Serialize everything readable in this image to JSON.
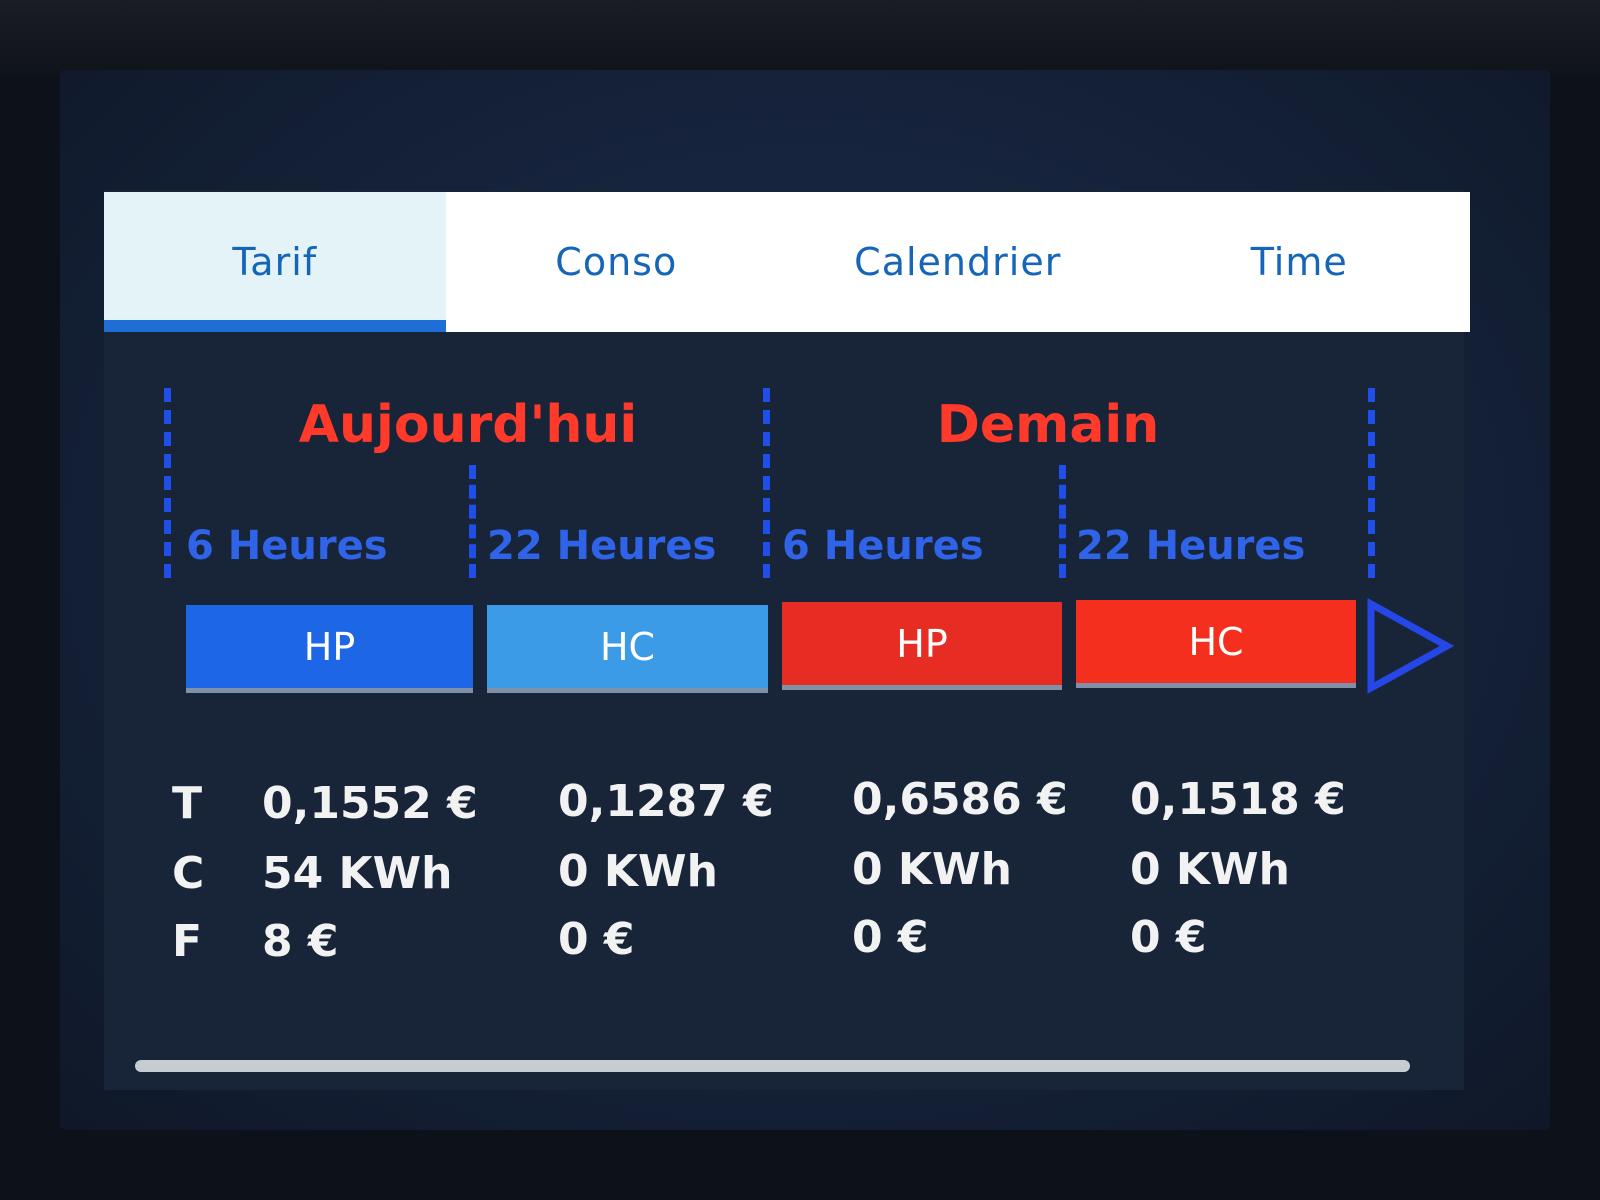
{
  "tabs": [
    {
      "label": "Tarif",
      "active": true
    },
    {
      "label": "Conso",
      "active": false
    },
    {
      "label": "Calendrier",
      "active": false
    },
    {
      "label": "Time",
      "active": false
    }
  ],
  "days": [
    {
      "title": "Aujourd'hui"
    },
    {
      "title": "Demain"
    }
  ],
  "periods": [
    {
      "hour": "6 Heures",
      "code": "HP",
      "color": "#1d66e6"
    },
    {
      "hour": "22 Heures",
      "code": "HC",
      "color": "#3c9be6"
    },
    {
      "hour": "6 Heures",
      "code": "HP",
      "color": "#e72d23"
    },
    {
      "hour": "22 Heures",
      "code": "HC",
      "color": "#f42f1e"
    }
  ],
  "next_icon": "play-arrow-icon",
  "rows": [
    {
      "label": "T",
      "values": [
        "0,1552 €",
        "0,1287 €",
        "0,6586 €",
        "0,1518 €"
      ]
    },
    {
      "label": "C",
      "values": [
        "54 KWh",
        "0 KWh",
        "0 KWh",
        "0 KWh"
      ]
    },
    {
      "label": "F",
      "values": [
        "8 €",
        "0 €",
        "0 €",
        "0 €"
      ]
    }
  ],
  "colors": {
    "accent": "#1e6ed6",
    "day_title": "#ff3a2a",
    "hour_text": "#2f63e8"
  }
}
